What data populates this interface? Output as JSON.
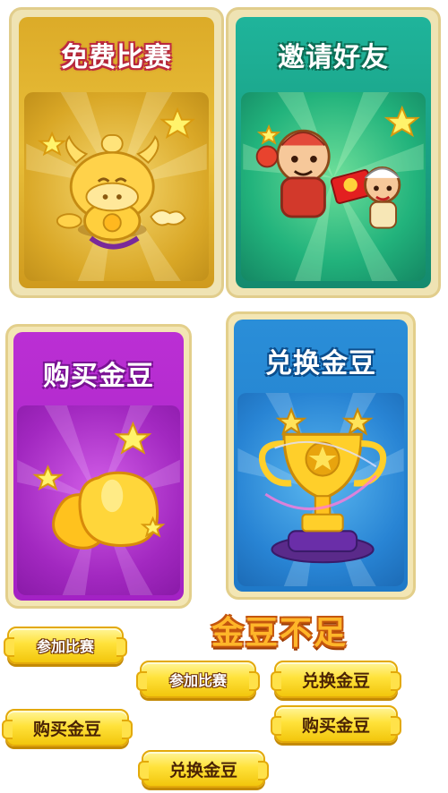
{
  "cards": {
    "free_match": {
      "title": "免费比赛",
      "icon": "gold-ox-icon"
    },
    "invite_friends": {
      "title": "邀请好友",
      "icon": "invite-characters-icon"
    },
    "buy_beans": {
      "title": "购买金豆",
      "icon": "gold-beans-icon"
    },
    "exchange_beans": {
      "title": "兑换金豆",
      "icon": "trophy-icon"
    }
  },
  "notice": {
    "title": "金豆不足"
  },
  "buttons": {
    "join_match_1": "参加比赛",
    "join_match_2": "参加比赛",
    "exchange_1": "兑换金豆",
    "buy_1": "购买金豆",
    "buy_2": "购买金豆",
    "exchange_2": "兑换金豆"
  },
  "colors": {
    "gold": "#e9bf3a",
    "green": "#1aa185",
    "purple": "#a322c4",
    "blue": "#1f79c8",
    "button_yellow": "#ffe23a"
  }
}
